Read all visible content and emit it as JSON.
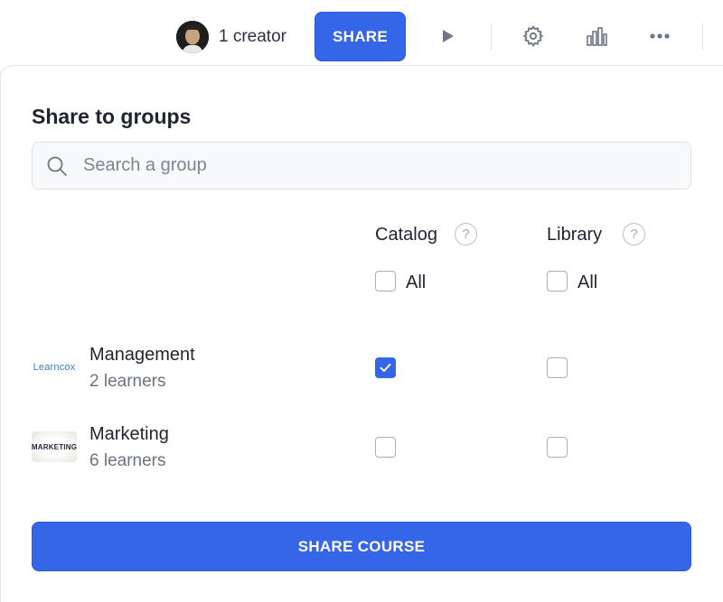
{
  "header": {
    "creator_label": "1 creator",
    "share_label": "SHARE",
    "icons": [
      "play-icon",
      "gear-icon",
      "bar-chart-icon",
      "more-icon"
    ]
  },
  "panel": {
    "title": "Share to groups",
    "search_placeholder": "Search a group",
    "columns": [
      {
        "label": "Catalog",
        "help": "?",
        "all_label": "All",
        "all_checked": false
      },
      {
        "label": "Library",
        "help": "?",
        "all_label": "All",
        "all_checked": false
      }
    ],
    "groups": [
      {
        "logo_text": "Learncox",
        "name": "Management",
        "count": "2 learners",
        "catalog": true,
        "library": false
      },
      {
        "logo_text": "MARKETING",
        "name": "Marketing",
        "count": "6 learners",
        "catalog": false,
        "library": false
      }
    ],
    "submit_label": "SHARE COURSE"
  },
  "colors": {
    "accent": "#3566e8",
    "text": "#1f2430",
    "muted": "#6b7280"
  }
}
